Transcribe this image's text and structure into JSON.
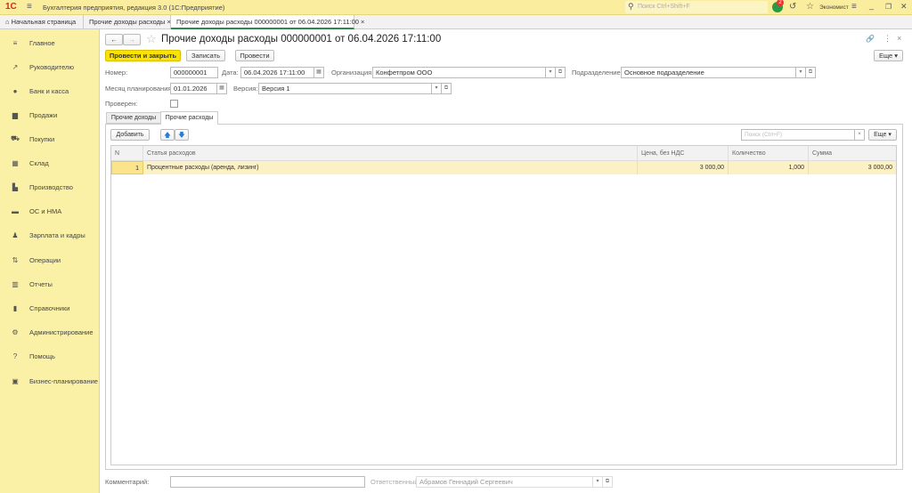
{
  "app": {
    "logo": "1С",
    "title": "Бухгалтерия предприятия, редакция 3.0  (1С:Предприятие)",
    "search_placeholder": "Поиск Ctrl+Shift+F",
    "notifications_count": "2",
    "user": "Экономист"
  },
  "window_tabs": [
    {
      "label": "Начальная страница"
    },
    {
      "label": "Прочие доходы расходы"
    },
    {
      "label": "Прочие доходы расходы 000000001 от 06.04.2026 17:11:00"
    }
  ],
  "sidebar": {
    "items": [
      {
        "label": "Главное",
        "icon": "≡"
      },
      {
        "label": "Руководителю",
        "icon": "↗"
      },
      {
        "label": "Банк и касса",
        "icon": "●"
      },
      {
        "label": "Продажи",
        "icon": "▆"
      },
      {
        "label": "Покупки",
        "icon": "⛟"
      },
      {
        "label": "Склад",
        "icon": "▦"
      },
      {
        "label": "Производство",
        "icon": "▙"
      },
      {
        "label": "ОС и НМА",
        "icon": "▬"
      },
      {
        "label": "Зарплата и кадры",
        "icon": "♟"
      },
      {
        "label": "Операции",
        "icon": "⇅"
      },
      {
        "label": "Отчеты",
        "icon": "▥"
      },
      {
        "label": "Справочники",
        "icon": "▮"
      },
      {
        "label": "Администрирование",
        "icon": "⚙"
      },
      {
        "label": "Помощь",
        "icon": "?"
      },
      {
        "label": "Бизнес-планирование",
        "icon": "▣"
      }
    ]
  },
  "form": {
    "title": "Прочие доходы расходы 000000001 от 06.04.2026 17:11:00",
    "buttons": {
      "post_close": "Провести и закрыть",
      "save": "Записать",
      "post": "Провести",
      "more": "Еще"
    },
    "fields": {
      "number_label": "Номер:",
      "number": "000000001",
      "date_label": "Дата:",
      "date": "06.04.2026 17:11:00",
      "org_label": "Организация:",
      "org": "Конфетпром ООО",
      "dept_label": "Подразделение:",
      "dept": "Основное подразделение",
      "month_label": "Месяц планирования:",
      "month": "01.01.2026",
      "version_label": "Версия:",
      "version": "Версия 1",
      "checked_label": "Проверен:",
      "comment_label": "Комментарий:",
      "comment": "",
      "resp_label": "Ответственный:",
      "resp": "Абрамов Геннадий Сергеевич"
    },
    "tabs": [
      {
        "label": "Прочие доходы"
      },
      {
        "label": "Прочие расходы"
      }
    ],
    "table_toolbar": {
      "add": "Добавить",
      "search_placeholder": "Поиск (Ctrl+F)",
      "more": "Еще"
    },
    "table": {
      "columns": [
        "N",
        "Статья расходов",
        "Цена, без НДС",
        "Количество",
        "Сумма"
      ],
      "rows": [
        {
          "n": "1",
          "item": "Процентные расходы (аренда, лизинг)",
          "price": "3 000,00",
          "qty": "1,000",
          "sum": "3 000,00"
        }
      ]
    }
  }
}
